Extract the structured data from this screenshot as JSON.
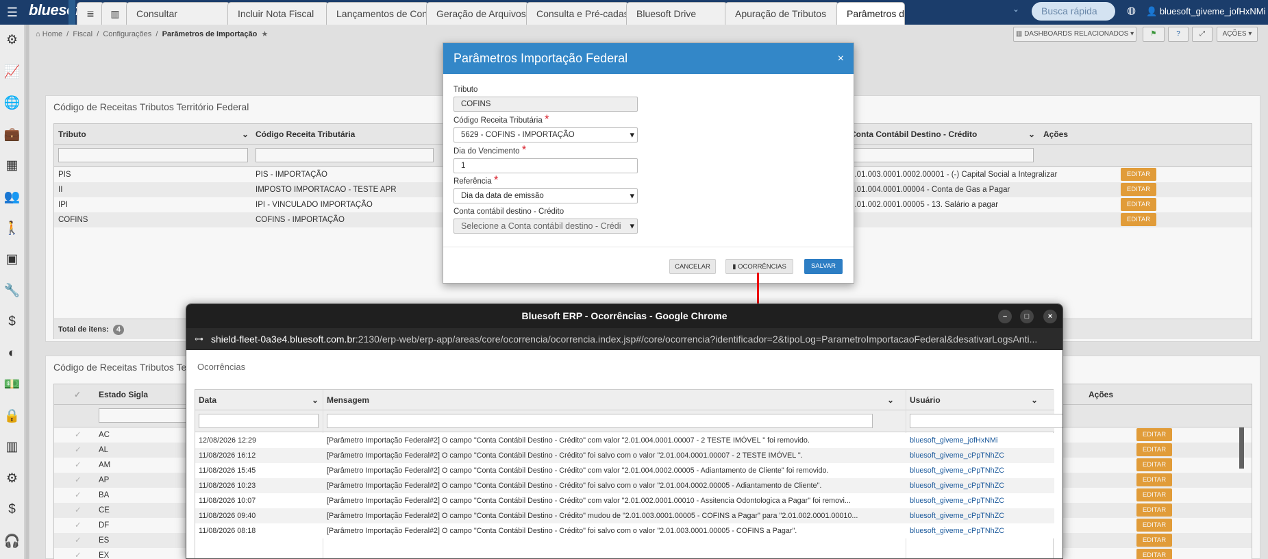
{
  "app": {
    "logo": "bluesoft",
    "search_placeholder": "Busca rápida",
    "user": "bluesoft_giveme_jofHxNMi"
  },
  "tabs": [
    {
      "label": "≣",
      "icon": "list-icon"
    },
    {
      "label": "▥",
      "icon": "chart-icon"
    },
    {
      "label": "Consultar"
    },
    {
      "label": "Incluir Nota Fiscal"
    },
    {
      "label": "Lançamentos de Conferên"
    },
    {
      "label": "Geração de Arquivos de E"
    },
    {
      "label": "Consulta e Pré-cadastro d"
    },
    {
      "label": "Bluesoft Drive"
    },
    {
      "label": "Apuração de Tributos"
    },
    {
      "label": "Parâmetros d"
    }
  ],
  "breadcrumb": {
    "home": "Home",
    "fiscal": "Fiscal",
    "config": "Configurações",
    "current": "Parâmetros de Importação"
  },
  "header_buttons": {
    "dashboards": "DASHBOARDS RELACIONADOS",
    "acoes": "AÇÕES"
  },
  "panel1": {
    "title": "Código de Receitas Tributos Território Federal",
    "headers": [
      "Tributo",
      "Código Receita Tributária",
      "Conta Contábil Destino - Crédito",
      "Ações"
    ],
    "rows": [
      [
        "PIS",
        "PIS - IMPORTAÇÃO",
        "2.01.003.0001.0002.00001 - (-) Capital Social a Integralizar",
        "EDITAR"
      ],
      [
        "II",
        "IMPOSTO IMPORTACAO - TESTE APR",
        "2.01.004.0001.00004 - Conta de Gas a Pagar",
        "EDITAR"
      ],
      [
        "IPI",
        "IPI - VINCULADO IMPORTAÇÃO",
        "2.01.002.0001.00005 - 13. Salário a pagar",
        "EDITAR"
      ],
      [
        "COFINS",
        "COFINS - IMPORTAÇÃO",
        "",
        "EDITAR"
      ]
    ],
    "total_label": "Total de itens:",
    "total": "4"
  },
  "panel2": {
    "title": "Código de Receitas Tributos Terr",
    "headers": [
      "Estado Sigla",
      "Ações"
    ],
    "rows": [
      "AC",
      "AL",
      "AM",
      "AP",
      "BA",
      "CE",
      "DF",
      "ES",
      "EX"
    ],
    "edit": "EDITAR"
  },
  "modal": {
    "title": "Parâmetros Importação Federal",
    "tributo_label": "Tributo",
    "tributo": "COFINS",
    "codigo_label": "Código Receita Tributária",
    "codigo": "5629 - COFINS - IMPORTAÇÃO",
    "dia_label": "Dia do Vencimento",
    "dia": "1",
    "ref_label": "Referência",
    "ref": "Dia da data de emissão",
    "conta_label": "Conta contábil destino - Crédito",
    "conta": "Selecione a Conta contábil destino - Crédi",
    "cancel": "CANCELAR",
    "ocorr": "OCORRÊNCIAS",
    "save": "SALVAR"
  },
  "chrome": {
    "title": "Bluesoft ERP - Ocorrências - Google Chrome",
    "url_host": "shield-fleet-0a3e4.bluesoft.com.br",
    "url_rest": ":2130/erp-web/erp-app/areas/core/ocorrencia/ocorrencia.index.jsp#/core/ocorrencia?identificador=2&tipoLog=ParametroImportacaoFederal&desativarLogsAnti..."
  },
  "ocorrencias": {
    "title": "Ocorrências",
    "headers": [
      "Data",
      "Mensagem",
      "Usuário"
    ],
    "rows": [
      [
        "12/08/2026 12:29",
        "[Parâmetro Importação Federal#2] O campo \"Conta Contábil Destino - Crédito\" com valor \"2.01.004.0001.00007 - 2 TESTE IMÓVEL \" foi removido.",
        "bluesoft_giveme_jofHxNMi"
      ],
      [
        "11/08/2026 16:12",
        "[Parâmetro Importação Federal#2] O campo \"Conta Contábil Destino - Crédito\" foi salvo com o valor \"2.01.004.0001.00007 - 2 TESTE IMÓVEL \".",
        "bluesoft_giveme_cPpTNhZC"
      ],
      [
        "11/08/2026 15:45",
        "[Parâmetro Importação Federal#2] O campo \"Conta Contábil Destino - Crédito\" com valor \"2.01.004.0002.00005 - Adiantamento de Cliente\" foi removido.",
        "bluesoft_giveme_cPpTNhZC"
      ],
      [
        "11/08/2026 10:23",
        "[Parâmetro Importação Federal#2] O campo \"Conta Contábil Destino - Crédito\" foi salvo com o valor \"2.01.004.0002.00005 - Adiantamento de Cliente\".",
        "bluesoft_giveme_cPpTNhZC"
      ],
      [
        "11/08/2026 10:07",
        "[Parâmetro Importação Federal#2] O campo \"Conta Contábil Destino - Crédito\" com valor \"2.01.002.0001.00010 - Assitencia Odontologica a Pagar\" foi removi...",
        "bluesoft_giveme_cPpTNhZC"
      ],
      [
        "11/08/2026 09:40",
        "[Parâmetro Importação Federal#2] O campo \"Conta Contábil Destino - Crédito\" mudou de \"2.01.003.0001.00005 - COFINS a Pagar\" para \"2.01.002.0001.00010...",
        "bluesoft_giveme_cPpTNhZC"
      ],
      [
        "11/08/2026 08:18",
        "[Parâmetro Importação Federal#2] O campo \"Conta Contábil Destino - Crédito\" foi salvo com o valor \"2.01.003.0001.00005 - COFINS a Pagar\".",
        "bluesoft_giveme_cPpTNhZC"
      ]
    ]
  }
}
